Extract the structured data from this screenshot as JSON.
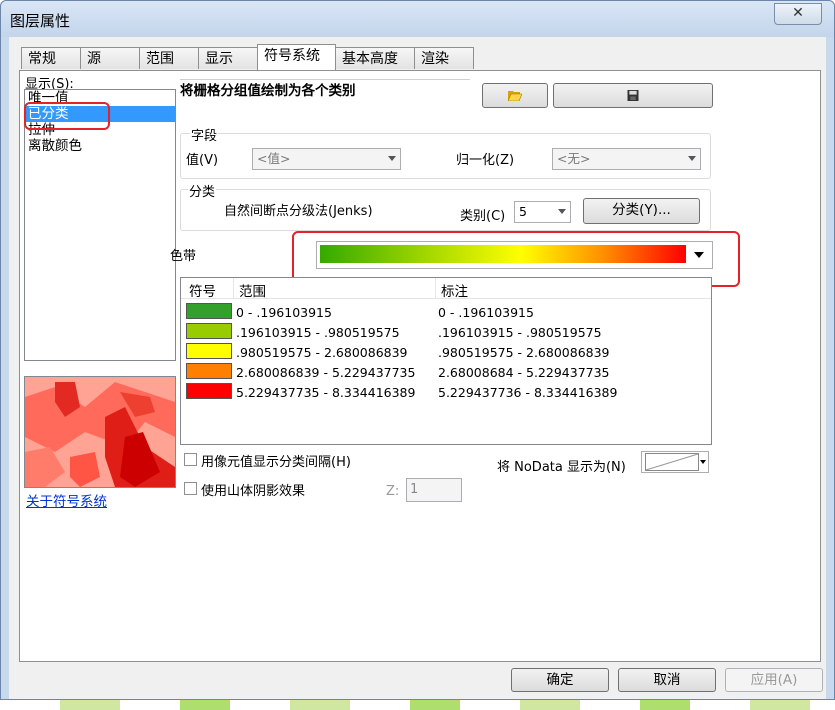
{
  "window": {
    "title": "图层属性",
    "close_label": "✕"
  },
  "tabs": [
    {
      "label": "常规"
    },
    {
      "label": "源"
    },
    {
      "label": "范围"
    },
    {
      "label": "显示"
    },
    {
      "label": "符号系统"
    },
    {
      "label": "基本高度"
    },
    {
      "label": "渲染"
    }
  ],
  "active_tab_index": 4,
  "show": {
    "label": "显示(S):",
    "items": [
      {
        "label": "唯一值",
        "selected": false
      },
      {
        "label": "已分类",
        "selected": true
      },
      {
        "label": "拉伸",
        "selected": false
      },
      {
        "label": "离散颜色",
        "selected": false
      }
    ],
    "about_link": "关于符号系统"
  },
  "heading": "将栅格分组值绘制为各个类别",
  "toolbar": {
    "open_icon": "folder-open-icon",
    "save_icon": "floppy-save-icon"
  },
  "field": {
    "group_label": "字段",
    "value_label": "值(V)",
    "value_selected": "<值>",
    "normalize_label": "归一化(Z)",
    "normalize_selected": "<无>"
  },
  "classification": {
    "group_label": "分类",
    "method": "自然间断点分级法(Jenks)",
    "classes_label": "类别(C)",
    "classes_value": "5",
    "classify_button": "分类(Y)..."
  },
  "color_ramp": {
    "label": "色带"
  },
  "table": {
    "headers": {
      "symbol": "符号",
      "range": "范围",
      "label": "标注"
    },
    "rows": [
      {
        "color": "#33a02c",
        "range": "0 - .196103915",
        "label": "0 - .196103915"
      },
      {
        "color": "#99cc00",
        "range": ".196103915 - .980519575",
        "label": ".196103915 - .980519575"
      },
      {
        "color": "#ffff00",
        "range": ".980519575 - 2.680086839",
        "label": ".980519575 - 2.680086839"
      },
      {
        "color": "#ff8000",
        "range": "2.680086839 - 5.229437735",
        "label": "2.68008684 - 5.229437735"
      },
      {
        "color": "#ff0000",
        "range": "5.229437735 - 8.334416389",
        "label": "5.229437736 - 8.334416389"
      }
    ]
  },
  "options": {
    "show_class_breaks": "用像元值显示分类间隔(H)",
    "use_hillshade": "使用山体阴影效果",
    "z_label": "Z:",
    "z_value": "1",
    "nodata_label": "将 NoData 显示为(N)"
  },
  "buttons": {
    "ok": "确定",
    "cancel": "取消",
    "apply": "应用(A)"
  },
  "colors": {
    "highlight": "#e3222a",
    "selection": "#3399ff"
  }
}
